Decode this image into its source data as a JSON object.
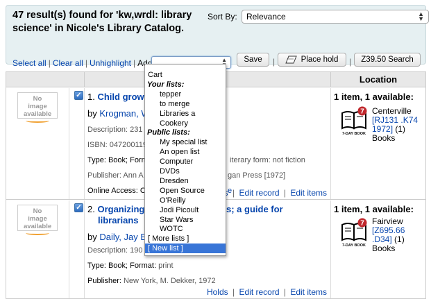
{
  "header": {
    "results_heading": "47 result(s) found for 'kw,wrdl: library science' in Nicole's Library Catalog.",
    "sortby_label": "Sort By:",
    "sortby_value": "Relevance",
    "select_all": "Select all",
    "clear_all": "Clear all",
    "unhighlight": "Unhighlight",
    "add_to_label": "Add to:",
    "save_label": "Save",
    "place_hold_label": "Place hold",
    "z3950_label": "Z39.50 Search"
  },
  "table": {
    "location_header": "Location"
  },
  "results": [
    {
      "noimage": "No image available",
      "number": "1.",
      "title": "Child grow",
      "by_prefix": "by",
      "author": "Krogman, W",
      "description": "Description: 231",
      "isbn": "ISBN: 047200119",
      "type_line": "Type: Book; Format:",
      "literary": "iterary form: not fiction",
      "publisher": "Publisher: Ann A",
      "publisher_tail": "gan Press [1972]",
      "online": "Online Access: C",
      "online_tail": "e",
      "actions": [
        "olds",
        "Edit record",
        "Edit items"
      ],
      "avail": "1 item, 1 available:",
      "branch": "Centerville",
      "callno": "[RJ131 .K74 1972]",
      "count": "(1)",
      "itemtype": "Books"
    },
    {
      "noimage": "No image available",
      "number": "2.",
      "title_a": "Organizing",
      "title_b": "s; a guide for",
      "title_c": "librarians",
      "by_prefix": "by",
      "author": "Daily, Jay E",
      "description": "Description: 190",
      "type_prefix": "Type: Book; Format:",
      "type_value": "print",
      "publisher_prefix": "Publisher:",
      "publisher_value": "New York, M. Dekker, 1972",
      "actions": [
        "Holds",
        "Edit record",
        "Edit items"
      ],
      "avail": "1 item, 1 available:",
      "branch": "Fairview",
      "callno": "[Z695.66 .D34]",
      "count": "(1)",
      "itemtype": "Books"
    }
  ],
  "dropdown": {
    "options": [
      {
        "label": "Cart",
        "kind": "item"
      },
      {
        "label": "Your lists:",
        "kind": "group"
      },
      {
        "label": "tepper",
        "kind": "indent"
      },
      {
        "label": "to merge",
        "kind": "indent"
      },
      {
        "label": "Libraries a",
        "kind": "indent"
      },
      {
        "label": "Cookery",
        "kind": "indent"
      },
      {
        "label": "Public lists:",
        "kind": "group"
      },
      {
        "label": "My special list",
        "kind": "indent"
      },
      {
        "label": "An open list",
        "kind": "indent"
      },
      {
        "label": "Computer",
        "kind": "indent"
      },
      {
        "label": "DVDs",
        "kind": "indent"
      },
      {
        "label": "Dresden",
        "kind": "indent"
      },
      {
        "label": "Open Source",
        "kind": "indent"
      },
      {
        "label": "O'Reilly",
        "kind": "indent"
      },
      {
        "label": "Jodi Picoult",
        "kind": "indent"
      },
      {
        "label": "Star Wars",
        "kind": "indent"
      },
      {
        "label": "WOTC",
        "kind": "indent"
      },
      {
        "label": "[ More lists ]",
        "kind": "item"
      },
      {
        "label": "[ New list ]",
        "kind": "selected"
      }
    ]
  },
  "icons": {
    "book_icon_label": "7-DAY BOOK",
    "book_icon_badge": "7"
  },
  "colors": {
    "header_bg": "#e6f0f2",
    "link": "#0645ad",
    "selected": "#3875d7"
  }
}
